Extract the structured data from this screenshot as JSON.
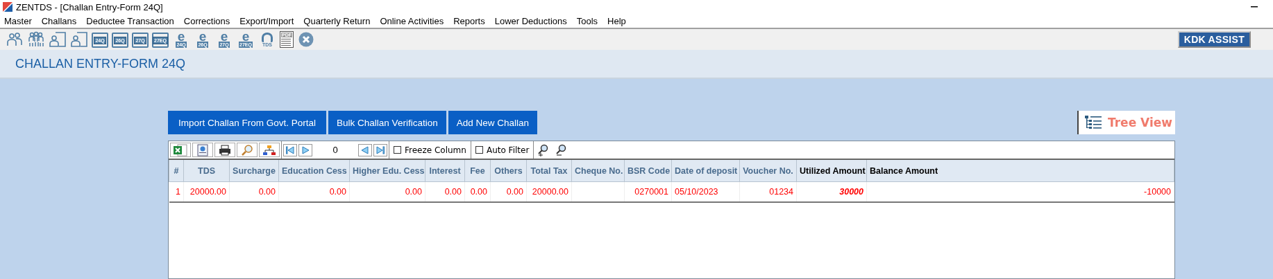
{
  "window": {
    "title": "ZENTDS - [Challan Entry-Form 24Q]"
  },
  "menu": [
    "Master",
    "Challans",
    "Deductee Transaction",
    "Corrections",
    "Export/Import",
    "Quarterly Return",
    "Online Activities",
    "Reports",
    "Lower Deductions",
    "Tools",
    "Help"
  ],
  "toolbar": [
    {
      "kind": "users"
    },
    {
      "kind": "group"
    },
    {
      "kind": "person_form"
    },
    {
      "kind": "person_form"
    },
    {
      "kind": "form",
      "label": "24Q"
    },
    {
      "kind": "form",
      "label": "26Q"
    },
    {
      "kind": "form",
      "label": "27Q"
    },
    {
      "kind": "form",
      "label": "27EQ"
    },
    {
      "kind": "etds",
      "mark": "e",
      "label": "24Q"
    },
    {
      "kind": "etds",
      "mark": "e",
      "label": "26Q"
    },
    {
      "kind": "etds",
      "mark": "e",
      "label": "27Q"
    },
    {
      "kind": "etds",
      "mark": "e",
      "label": "27EQ"
    },
    {
      "kind": "emblem",
      "label": "TDS"
    },
    {
      "kind": "pdf",
      "label": "PDF"
    },
    {
      "kind": "close"
    }
  ],
  "assist_button": "KDK ASSIST",
  "page_title": "CHALLAN ENTRY-FORM 24Q",
  "actions": [
    "Import Challan From Govt. Portal",
    "Bulk Challan Verification",
    "Add New Challan"
  ],
  "tree_view": "Tree View",
  "grid": {
    "record": "0",
    "options": [
      {
        "label": "Freeze Column",
        "checked": false
      },
      {
        "label": "Auto Filter",
        "checked": false
      }
    ],
    "columns": [
      {
        "label": "#",
        "kind": "number"
      },
      {
        "label": "TDS",
        "kind": "number"
      },
      {
        "label": "Surcharge",
        "kind": "number"
      },
      {
        "label": "Education Cess",
        "kind": "number"
      },
      {
        "label": "Higher Edu. Cess",
        "kind": "number"
      },
      {
        "label": "Interest",
        "kind": "number"
      },
      {
        "label": "Fee",
        "kind": "number"
      },
      {
        "label": "Others",
        "kind": "number"
      },
      {
        "label": "Total Tax",
        "kind": "number"
      },
      {
        "label": "Cheque No.",
        "kind": "number"
      },
      {
        "label": "BSR Code",
        "kind": "number"
      },
      {
        "label": "Date of deposit",
        "kind": "date"
      },
      {
        "label": "Voucher No.",
        "kind": "number"
      },
      {
        "label": "Utilized Amount",
        "kind": "utilized"
      },
      {
        "label": "Balance Amount",
        "kind": "summary"
      }
    ],
    "rows": [
      [
        "1",
        "20000.00",
        "0.00",
        "0.00",
        "0.00",
        "0.00",
        "0.00",
        "0.00",
        "20000.00",
        null,
        "0270001",
        "05/10/2023",
        "01234",
        "30000",
        "-10000"
      ]
    ]
  }
}
